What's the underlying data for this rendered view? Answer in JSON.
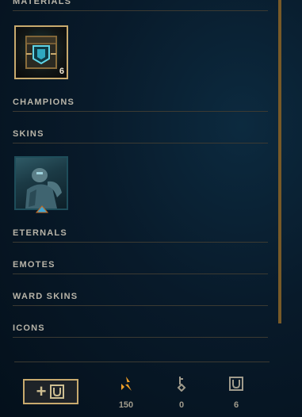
{
  "sections": {
    "materials": "MATERIALS",
    "champions": "CHAMPIONS",
    "skins": "SKINS",
    "eternals": "ETERNALS",
    "emotes": "EMOTES",
    "ward_skins": "WARD SKINS",
    "icons": "ICONS"
  },
  "materials_tile": {
    "count": "6",
    "icon": "hextech-chest-icon"
  },
  "skins_tile": {
    "icon": "champion-skin-portrait"
  },
  "footer": {
    "add_button_icon": "add-chest-icon",
    "orange_essence": {
      "icon": "orange-essence-icon",
      "value": "150"
    },
    "keys": {
      "icon": "key-icon",
      "value": "0"
    },
    "chests": {
      "icon": "chest-icon",
      "value": "6"
    }
  },
  "colors": {
    "gold_accent": "#c8aa6e",
    "essence_orange": "#f0a028",
    "background": "#081a2a"
  }
}
